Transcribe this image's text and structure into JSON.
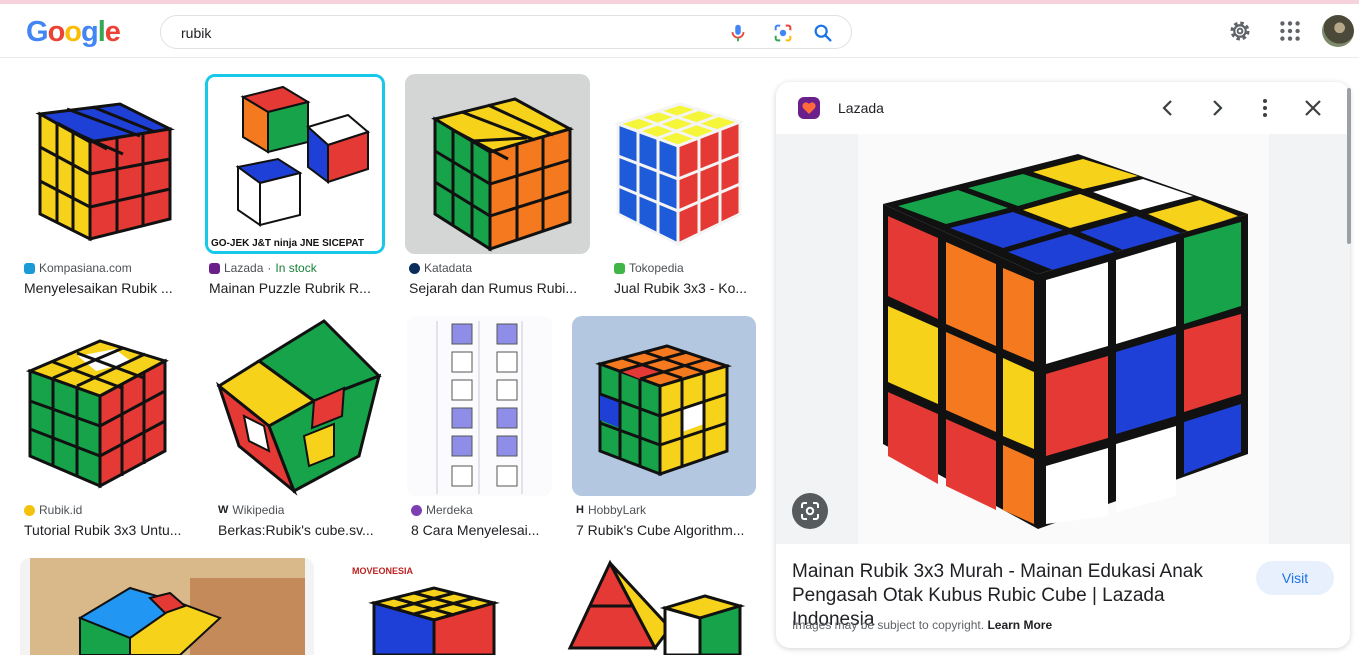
{
  "logo": {
    "letters": [
      "G",
      "o",
      "o",
      "g",
      "l",
      "e"
    ],
    "colors": [
      "#4285F4",
      "#EA4335",
      "#FBBC05",
      "#4285F4",
      "#34A853",
      "#EA4335"
    ]
  },
  "search": {
    "query": "rubik",
    "mic_icon": "mic-icon",
    "lens_icon": "lens-icon",
    "search_icon": "search-icon"
  },
  "header_icons": [
    "settings-icon",
    "apps-grid-icon"
  ],
  "results": [
    {
      "source": "Kompasiana.com",
      "title": "Menyelesaikan Rubik ...",
      "fav": "#1a9ad6"
    },
    {
      "source": "Lazada",
      "stock": "In stock",
      "sep": " · ",
      "title": "Mainan Puzzle Rubrik R...",
      "fav": "#6b1f8a"
    },
    {
      "source": "Katadata",
      "title": "Sejarah dan Rumus Rubi...",
      "fav": "#0b2d5b"
    },
    {
      "source": "Tokopedia",
      "title": "Jual Rubik 3x3 - Ko...",
      "fav": "#42b549"
    },
    {
      "source": "Rubik.id",
      "title": "Tutorial Rubik 3x3 Untu...",
      "fav": "#f4c20d"
    },
    {
      "source": "Wikipedia",
      "title": "Berkas:Rubik's cube.sv...",
      "fav": "#555555"
    },
    {
      "source": "Merdeka",
      "title": "8 Cara Menyelesai...",
      "fav": "#7b3fb2"
    },
    {
      "source": "HobbyLark",
      "title": "7 Rubik's Cube Algorithm...",
      "fav": "#222222"
    }
  ],
  "thumb_labels": {
    "card2_brands": "GO-JEK  J&T  ninja  JNE  SICEPAT",
    "card10_brand": "MOVEONESIA"
  },
  "panel": {
    "source": "Lazada",
    "title": "Mainan Rubik 3x3 Murah - Mainan Edukasi Anak Pengasah Otak Kubus Rubic Cube | Lazada Indonesia",
    "visit": "Visit",
    "copyright": "Images may be subject to copyright.",
    "learn_more": "Learn More"
  },
  "colors": {
    "cube_red": "#e53935",
    "cube_blue": "#1e40d6",
    "cube_yellow": "#f7d21a",
    "cube_green": "#16a34a",
    "cube_orange": "#f57a1f",
    "cube_white": "#ffffff",
    "accent": "#1a73e8"
  }
}
